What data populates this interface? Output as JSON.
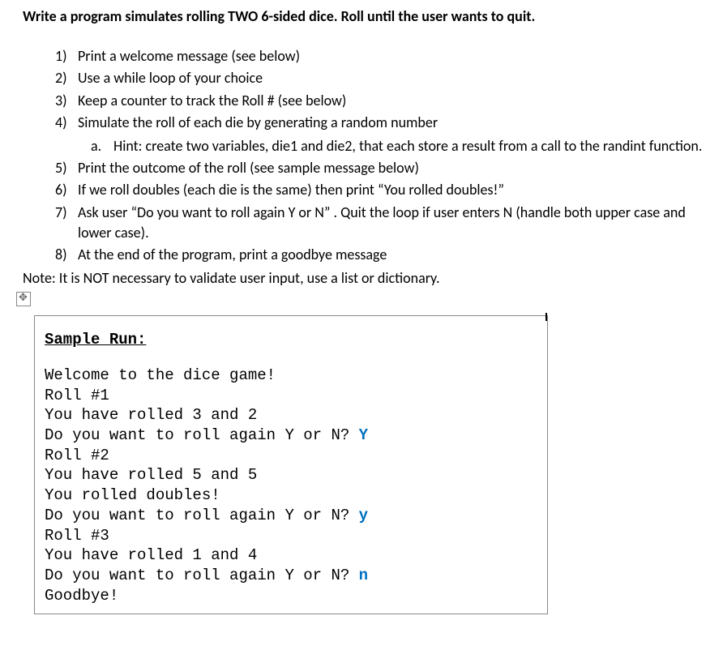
{
  "title": "Write a program simulates rolling TWO 6-sided dice.  Roll until the user wants to quit.",
  "items": [
    {
      "num": "1)",
      "text": "Print a welcome message (see below)"
    },
    {
      "num": "2)",
      "text": "Use a while loop of your choice"
    },
    {
      "num": "3)",
      "text": "Keep a counter to track the Roll # (see below)"
    },
    {
      "num": "4)",
      "text": "Simulate the roll of each die by generating a random number"
    }
  ],
  "subitems": [
    {
      "letter": "a.",
      "text": "Hint:  create two variables, die1 and die2, that each store a result from a call to the randint function."
    }
  ],
  "items2": [
    {
      "num": "5)",
      "text": "Print the outcome of the roll (see sample message below)"
    },
    {
      "num": "6)",
      "text": "If we roll doubles (each die is the same) then print “You rolled doubles!”"
    },
    {
      "num": "7)",
      "text": "Ask user “Do you want to roll again Y or N” .  Quit the loop if user enters N (handle both upper case and lower case)."
    },
    {
      "num": "8)",
      "text": "At the end of the program, print a goodbye message"
    }
  ],
  "note": "Note:  It is NOT necessary to validate user input, use a list or dictionary.",
  "sample": {
    "header": "Sample Run:",
    "lines": [
      {
        "text": "Welcome to the dice game!",
        "input": ""
      },
      {
        "text": "Roll #1",
        "input": ""
      },
      {
        "text": "You have rolled 3 and 2",
        "input": ""
      },
      {
        "text": "Do you want to roll again Y or N? ",
        "input": "Y"
      },
      {
        "text": "Roll #2",
        "input": ""
      },
      {
        "text": "You have rolled 5 and 5",
        "input": ""
      },
      {
        "text": "You rolled doubles!",
        "input": ""
      },
      {
        "text": "Do you want to roll again Y or N? ",
        "input": "y"
      },
      {
        "text": "Roll #3",
        "input": ""
      },
      {
        "text": "You have rolled 1 and 4",
        "input": ""
      },
      {
        "text": "Do you want to roll again Y or N? ",
        "input": "n"
      },
      {
        "text": "Goodbye!",
        "input": ""
      }
    ]
  }
}
